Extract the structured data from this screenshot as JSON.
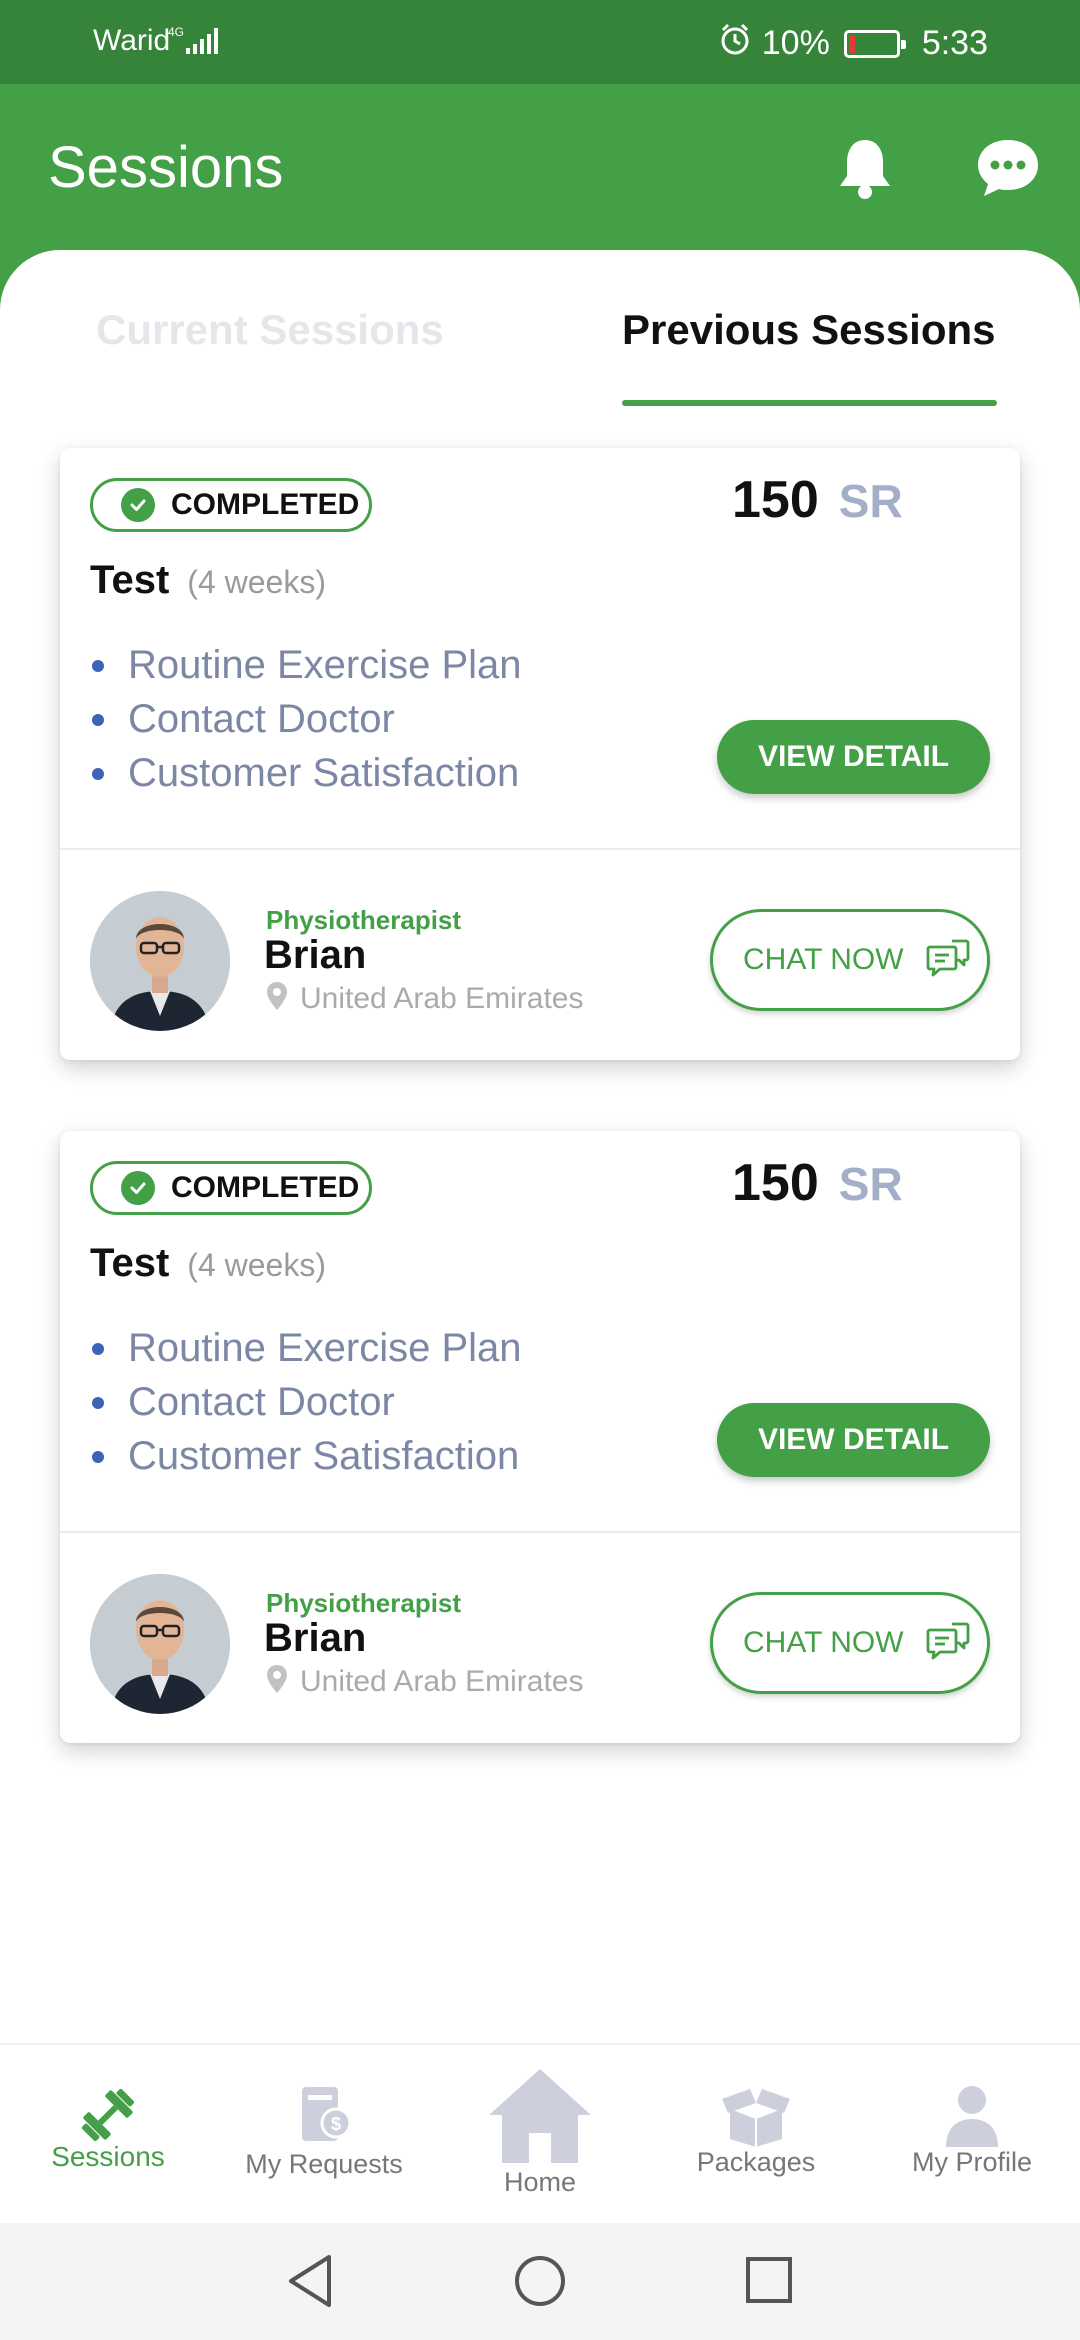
{
  "status_bar": {
    "carrier": "Warid",
    "network": "4G",
    "battery": "10%",
    "time": "5:33"
  },
  "header": {
    "title": "Sessions"
  },
  "tabs": [
    {
      "label": "Current Sessions",
      "active": false
    },
    {
      "label": "Previous Sessions",
      "active": true
    }
  ],
  "sessions": [
    {
      "status": "COMPLETED",
      "price": "150",
      "currency": "SR",
      "plan": "Test",
      "duration": "(4 weeks)",
      "features": [
        "Routine Exercise Plan",
        "Contact Doctor",
        "Customer Satisfaction"
      ],
      "view_label": "VIEW DETAIL",
      "doctor": {
        "role": "Physiotherapist",
        "name": "Brian",
        "location": "United Arab Emirates"
      },
      "chat_label": "CHAT NOW"
    },
    {
      "status": "COMPLETED",
      "price": "150",
      "currency": "SR",
      "plan": "Test",
      "duration": "(4 weeks)",
      "features": [
        "Routine Exercise Plan",
        "Contact Doctor",
        "Customer Satisfaction"
      ],
      "view_label": "VIEW DETAIL",
      "doctor": {
        "role": "Physiotherapist",
        "name": "Brian",
        "location": "United Arab Emirates"
      },
      "chat_label": "CHAT NOW"
    }
  ],
  "bottom_nav": [
    {
      "label": "Sessions",
      "icon": "dumbbell-icon",
      "active": true
    },
    {
      "label": "My Requests",
      "icon": "requests-icon",
      "active": false
    },
    {
      "label": "Home",
      "icon": "home-icon",
      "active": false
    },
    {
      "label": "Packages",
      "icon": "packages-icon",
      "active": false
    },
    {
      "label": "My Profile",
      "icon": "profile-icon",
      "active": false
    }
  ],
  "colors": {
    "primary": "#44a047",
    "status_bar": "#35843a",
    "feature_text": "#7b87a4",
    "currency": "#a3afc8"
  }
}
